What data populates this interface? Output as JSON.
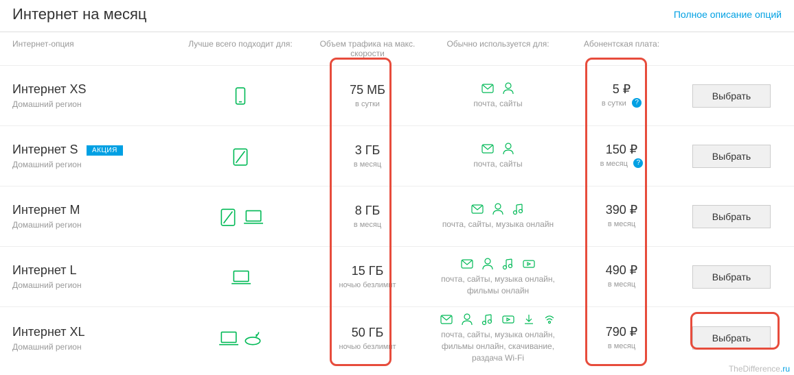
{
  "header": {
    "title": "Интернет на месяц",
    "link": "Полное описание опций"
  },
  "columns": {
    "c1": "Интернет-опция",
    "c2": "Лучше всего подходит для:",
    "c3": "Объем трафика на макс. скорости",
    "c4": "Обычно используется для:",
    "c5": "Абонентская плата:"
  },
  "plans": [
    {
      "name": "Интернет XS",
      "sub": "Домашний регион",
      "badge": "",
      "devices": [
        "phone"
      ],
      "volume": "75 МБ",
      "volume_sub": "в сутки",
      "usage_icons": [
        "mail",
        "person"
      ],
      "usage": "почта, сайты",
      "price": "5 ₽",
      "price_sub": "в сутки",
      "info": true,
      "btn": "Выбрать"
    },
    {
      "name": "Интернет S",
      "sub": "Домашний регион",
      "badge": "АКЦИЯ",
      "devices": [
        "tablet"
      ],
      "volume": "3 ГБ",
      "volume_sub": "в месяц",
      "usage_icons": [
        "mail",
        "person"
      ],
      "usage": "почта, сайты",
      "price": "150 ₽",
      "price_sub": "в месяц",
      "info": true,
      "btn": "Выбрать"
    },
    {
      "name": "Интернет M",
      "sub": "Домашний регион",
      "badge": "",
      "devices": [
        "tablet",
        "laptop"
      ],
      "volume": "8 ГБ",
      "volume_sub": "в месяц",
      "usage_icons": [
        "mail",
        "person",
        "music"
      ],
      "usage": "почта, сайты, музыка онлайн",
      "price": "390 ₽",
      "price_sub": "в месяц",
      "info": false,
      "btn": "Выбрать"
    },
    {
      "name": "Интернет L",
      "sub": "Домашний регион",
      "badge": "",
      "devices": [
        "laptop"
      ],
      "volume": "15 ГБ",
      "volume_sub": "ночью безлимит",
      "usage_icons": [
        "mail",
        "person",
        "music",
        "video"
      ],
      "usage": "почта, сайты, музыка онлайн, фильмы онлайн",
      "price": "490 ₽",
      "price_sub": "в месяц",
      "info": false,
      "btn": "Выбрать"
    },
    {
      "name": "Интернет XL",
      "sub": "Домашний регион",
      "badge": "",
      "devices": [
        "laptop",
        "router"
      ],
      "volume": "50 ГБ",
      "volume_sub": "ночью безлимит",
      "usage_icons": [
        "mail",
        "person",
        "music",
        "video",
        "download",
        "wifi"
      ],
      "usage": "почта, сайты, музыка онлайн, фильмы онлайн, скачивание, раздача Wi-Fi",
      "price": "790 ₽",
      "price_sub": "в месяц",
      "info": false,
      "btn": "Выбрать"
    }
  ],
  "watermark": {
    "a": "TheDifference",
    "b": ".ru"
  }
}
